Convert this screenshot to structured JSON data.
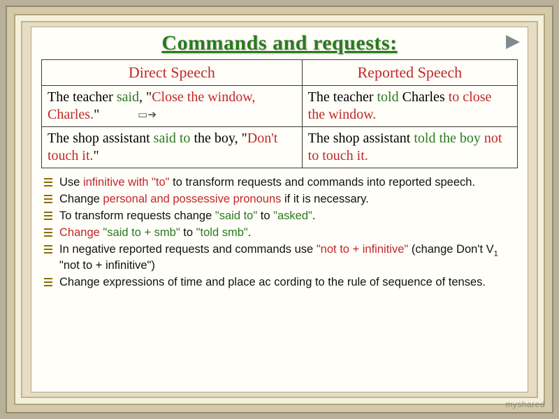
{
  "title": "Commands and requests:",
  "nav_icon": "▶",
  "table": {
    "headers": {
      "left": "Direct Speech",
      "right": "Reported Speech"
    },
    "rows": [
      {
        "direct": {
          "pre": "The teacher ",
          "verb": "said",
          "mid": ", \"",
          "hl": "Close the window, Charles.",
          "post": "\""
        },
        "reported": {
          "pre": "The teacher ",
          "verb": "told",
          "mid": " Charles ",
          "hl": "to close the window.",
          "post": ""
        }
      },
      {
        "direct": {
          "pre": "The shop assistant ",
          "verb": "said to",
          "mid": " the boy, \"",
          "hl": "Don't touch it.",
          "post": "\""
        },
        "reported": {
          "pre": "The shop assistant ",
          "verb": "told the boy",
          "mid": " ",
          "hl": "not to touch it.",
          "post": ""
        }
      }
    ]
  },
  "bullets": [
    {
      "pre": "Use ",
      "r1": "infinitive with \"to\"",
      "mid1": " to transform requests and commands into reported speech.",
      "r2": "",
      "mid2": "",
      "r3": "",
      "post": ""
    },
    {
      "pre": " Change ",
      "r1": "personal and possessive pronouns",
      "mid1": " if it is necessary.",
      "r2": "",
      "mid2": "",
      "r3": "",
      "post": ""
    },
    {
      "pre": " To transform requests change ",
      "r1": "\"said to\"",
      "mid1": " to ",
      "r2": "\"asked\"",
      "mid2": ".",
      "r3": "",
      "post": ""
    },
    {
      "pre": " ",
      "r1": "Change",
      "mid1": " ",
      "r2": "\"said to + smb\"",
      "mid2": " to ",
      "r3": "\"told smb\"",
      "post": "."
    },
    {
      "pre": " In negative reported requests and commands use ",
      "r1": "\"not to + infinitive\"",
      "mid1": " (change Don't V",
      "r2": "",
      "mid2": "",
      "r3": "",
      "post": " \"not to + infinitive\")",
      "sub": "1"
    },
    {
      "pre": "Change expressions of time and place ac cording to the rule of sequence of tenses.",
      "r1": "",
      "mid1": "",
      "r2": "",
      "mid2": "",
      "r3": "",
      "post": ""
    }
  ],
  "watermark": "myshared"
}
